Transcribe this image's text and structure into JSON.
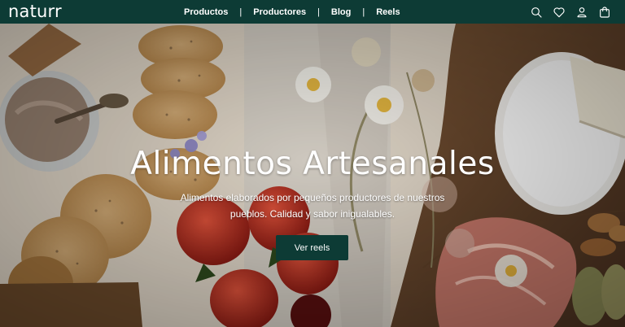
{
  "brand": {
    "logo_text": "naturr"
  },
  "nav": {
    "items": [
      {
        "label": "Productos"
      },
      {
        "label": "Productores"
      },
      {
        "label": "Blog"
      },
      {
        "label": "Reels"
      }
    ],
    "separator": "|"
  },
  "header_icons": [
    "search-icon",
    "heart-icon",
    "user-icon",
    "cart-icon"
  ],
  "hero": {
    "title": "Alimentos Artesanales",
    "subtitle": "Alimentos elaborados por pequeños productores de nuestros pueblos. Calidad y sabor inigualables.",
    "cta_label": "Ver reels"
  },
  "colors": {
    "brand_dark_green": "#0d3b35",
    "text_on_dark": "#ffffff"
  }
}
